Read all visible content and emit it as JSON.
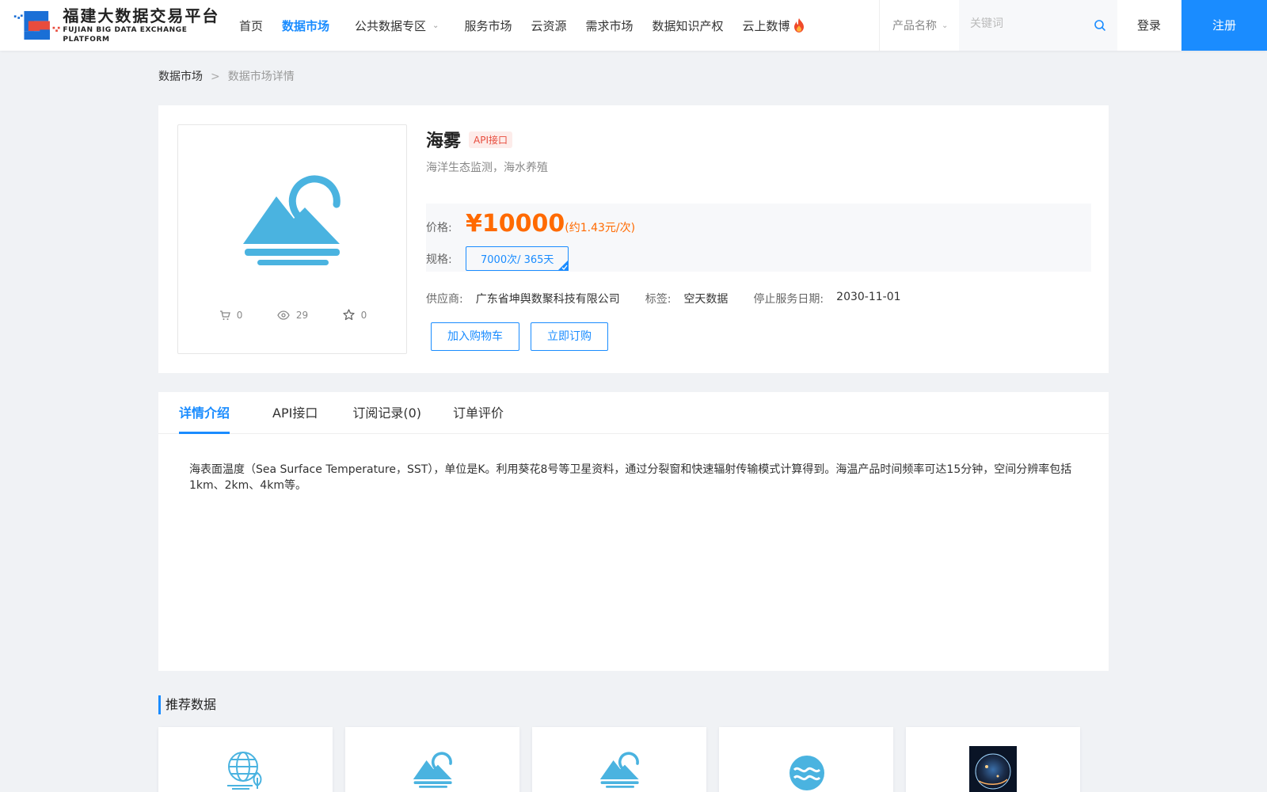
{
  "header": {
    "logo_cn": "福建大数据交易平台",
    "logo_en": "FUJIAN BIG DATA EXCHANGE  PLATFORM",
    "nav": [
      {
        "label": "首页",
        "active": false
      },
      {
        "label": "数据市场",
        "active": true
      },
      {
        "label": "公共数据专区",
        "active": false,
        "dropdown": true
      },
      {
        "label": "服务市场",
        "active": false
      },
      {
        "label": "云资源",
        "active": false
      },
      {
        "label": "需求市场",
        "active": false
      },
      {
        "label": "数据知识产权",
        "active": false
      },
      {
        "label": "云上数博",
        "active": false,
        "hot": true
      }
    ],
    "search": {
      "type_selected": "产品名称",
      "placeholder": "关键词",
      "value": ""
    },
    "login_label": "登录",
    "register_label": "注册"
  },
  "breadcrumb": {
    "parent": "数据市场",
    "separator": ">",
    "current": "数据市场详情"
  },
  "product": {
    "title": "海雾",
    "badge": "API接口",
    "subtitle": "海洋生态监测，海水养殖",
    "stats": {
      "cart": "0",
      "views": "29",
      "favorites": "0"
    },
    "price_label": "价格:",
    "price": "¥10000",
    "price_unit": "(约1.43元/次)",
    "spec_label": "规格:",
    "spec_value": "7000次/ 365天",
    "supplier_label": "供应商:",
    "supplier": "广东省坤舆数聚科技有限公司",
    "tag_label": "标签:",
    "tag": "空天数据",
    "end_date_label": "停止服务日期:",
    "end_date": "2030-11-01",
    "add_cart_label": "加入购物车",
    "subscribe_label": "立即订购"
  },
  "tabs": [
    {
      "label": "详情介绍",
      "active": true
    },
    {
      "label": "API接口",
      "active": false
    },
    {
      "label": "订阅记录(0)",
      "active": false
    },
    {
      "label": "订单评价",
      "active": false
    }
  ],
  "description": "海表面温度（Sea Surface Temperature，SST），单位是K。利用葵花8号等卫星资料，通过分裂窗和快速辐射传输模式计算得到。海温产品时间频率可达15分钟，空间分辨率包括1km、2km、4km等。",
  "recommended": {
    "title": "推荐数据",
    "cards": [
      {
        "icon": "globe-leaf-icon"
      },
      {
        "icon": "sea-fog-icon"
      },
      {
        "icon": "sea-fog-icon"
      },
      {
        "icon": "water-wave-icon"
      },
      {
        "icon": "earth-satellite-photo"
      }
    ]
  },
  "colors": {
    "primary": "#1a8cff",
    "price": "#ff6a00",
    "icon_blue": "#4ab3e0"
  }
}
